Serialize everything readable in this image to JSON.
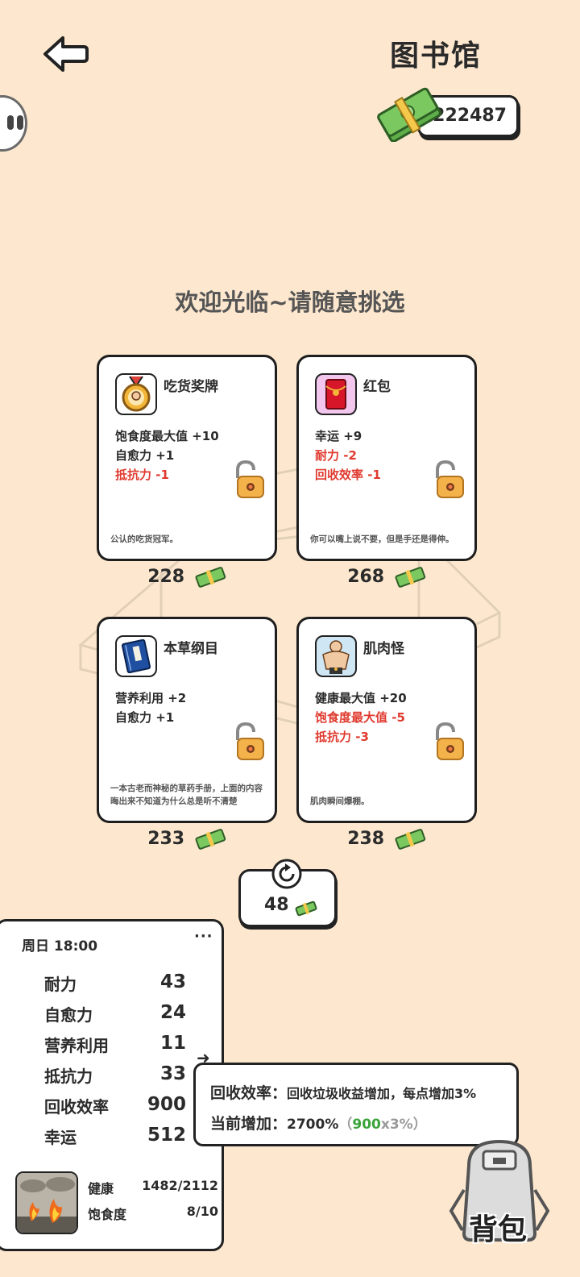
{
  "header": {
    "title": "图书馆",
    "money": "222487"
  },
  "welcome": "欢迎光临~请随意挑选",
  "cards": [
    {
      "name": "吃货奖牌",
      "stats": [
        {
          "text": "饱食度最大值 +10",
          "neg": false
        },
        {
          "text": "自愈力 +1",
          "neg": false
        },
        {
          "text": "抵抗力 -1",
          "neg": true
        }
      ],
      "desc": "公认的吃货冠军。",
      "price": "228",
      "icon": "medal-icon"
    },
    {
      "name": "红包",
      "stats": [
        {
          "text": "幸运 +9",
          "neg": false
        },
        {
          "text": "耐力 -2",
          "neg": true
        },
        {
          "text": "回收效率 -1",
          "neg": true
        }
      ],
      "desc": "你可以嘴上说不要，但是手还是得伸。",
      "price": "268",
      "icon": "red-envelope-icon"
    },
    {
      "name": "本草纲目",
      "stats": [
        {
          "text": "营养利用 +2",
          "neg": false
        },
        {
          "text": "自愈力 +1",
          "neg": false
        }
      ],
      "desc": "一本古老而神秘的草药手册，上面的内容晦出来不知道为什么总是听不清楚",
      "price": "233",
      "icon": "book-icon"
    },
    {
      "name": "肌肉怪",
      "stats": [
        {
          "text": "健康最大值 +20",
          "neg": false
        },
        {
          "text": "饱食度最大值 -5",
          "neg": true
        },
        {
          "text": "抵抗力 -3",
          "neg": true
        }
      ],
      "desc": "肌肉瞬间爆棚。",
      "price": "238",
      "icon": "muscle-man-icon"
    }
  ],
  "refresh": {
    "cost": "48"
  },
  "panel": {
    "time": "周日 18:00",
    "more": "···",
    "attributes": [
      {
        "label": "耐力",
        "value": "43"
      },
      {
        "label": "自愈力",
        "value": "24"
      },
      {
        "label": "营养利用",
        "value": "11"
      },
      {
        "label": "抵抗力",
        "value": "33"
      },
      {
        "label": "回收效率",
        "value": "900"
      },
      {
        "label": "幸运",
        "value": "512"
      }
    ],
    "health_label": "健康",
    "health_value": "1482/2112",
    "hunger_label": "饱食度",
    "hunger_value": "8/10"
  },
  "tooltip": {
    "line1_key": "回收效率：",
    "line1_text": "回收垃圾收益增加，每点增加3%",
    "line2_key": "当前增加：",
    "line2_value": "2700%",
    "line2_open": "（",
    "line2_green": "900",
    "line2_grey": "x3%",
    "line2_close": "）"
  },
  "bag": {
    "label": "背包"
  },
  "colors": {
    "background": "#fde8cf",
    "negative": "#e03a2f",
    "positive_highlight": "#3aa33a"
  }
}
